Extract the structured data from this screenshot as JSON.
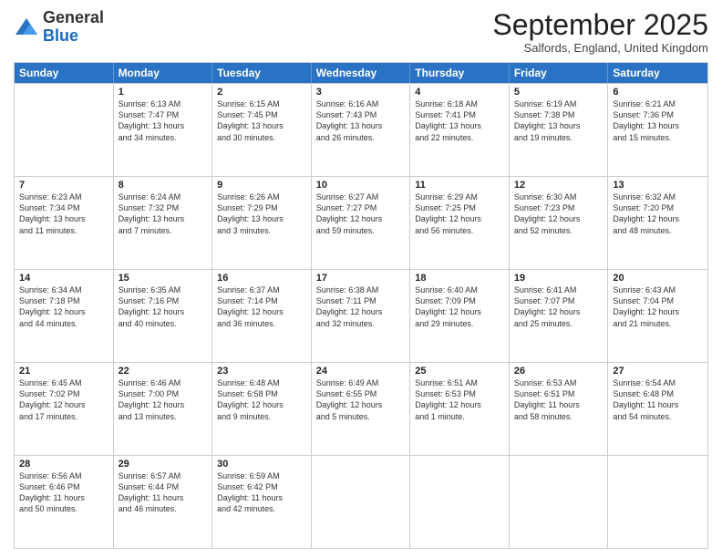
{
  "logo": {
    "general": "General",
    "blue": "Blue"
  },
  "header": {
    "month": "September 2025",
    "location": "Salfords, England, United Kingdom"
  },
  "days": [
    "Sunday",
    "Monday",
    "Tuesday",
    "Wednesday",
    "Thursday",
    "Friday",
    "Saturday"
  ],
  "weeks": [
    [
      {
        "date": "",
        "info": ""
      },
      {
        "date": "1",
        "info": "Sunrise: 6:13 AM\nSunset: 7:47 PM\nDaylight: 13 hours\nand 34 minutes."
      },
      {
        "date": "2",
        "info": "Sunrise: 6:15 AM\nSunset: 7:45 PM\nDaylight: 13 hours\nand 30 minutes."
      },
      {
        "date": "3",
        "info": "Sunrise: 6:16 AM\nSunset: 7:43 PM\nDaylight: 13 hours\nand 26 minutes."
      },
      {
        "date": "4",
        "info": "Sunrise: 6:18 AM\nSunset: 7:41 PM\nDaylight: 13 hours\nand 22 minutes."
      },
      {
        "date": "5",
        "info": "Sunrise: 6:19 AM\nSunset: 7:38 PM\nDaylight: 13 hours\nand 19 minutes."
      },
      {
        "date": "6",
        "info": "Sunrise: 6:21 AM\nSunset: 7:36 PM\nDaylight: 13 hours\nand 15 minutes."
      }
    ],
    [
      {
        "date": "7",
        "info": "Sunrise: 6:23 AM\nSunset: 7:34 PM\nDaylight: 13 hours\nand 11 minutes."
      },
      {
        "date": "8",
        "info": "Sunrise: 6:24 AM\nSunset: 7:32 PM\nDaylight: 13 hours\nand 7 minutes."
      },
      {
        "date": "9",
        "info": "Sunrise: 6:26 AM\nSunset: 7:29 PM\nDaylight: 13 hours\nand 3 minutes."
      },
      {
        "date": "10",
        "info": "Sunrise: 6:27 AM\nSunset: 7:27 PM\nDaylight: 12 hours\nand 59 minutes."
      },
      {
        "date": "11",
        "info": "Sunrise: 6:29 AM\nSunset: 7:25 PM\nDaylight: 12 hours\nand 56 minutes."
      },
      {
        "date": "12",
        "info": "Sunrise: 6:30 AM\nSunset: 7:23 PM\nDaylight: 12 hours\nand 52 minutes."
      },
      {
        "date": "13",
        "info": "Sunrise: 6:32 AM\nSunset: 7:20 PM\nDaylight: 12 hours\nand 48 minutes."
      }
    ],
    [
      {
        "date": "14",
        "info": "Sunrise: 6:34 AM\nSunset: 7:18 PM\nDaylight: 12 hours\nand 44 minutes."
      },
      {
        "date": "15",
        "info": "Sunrise: 6:35 AM\nSunset: 7:16 PM\nDaylight: 12 hours\nand 40 minutes."
      },
      {
        "date": "16",
        "info": "Sunrise: 6:37 AM\nSunset: 7:14 PM\nDaylight: 12 hours\nand 36 minutes."
      },
      {
        "date": "17",
        "info": "Sunrise: 6:38 AM\nSunset: 7:11 PM\nDaylight: 12 hours\nand 32 minutes."
      },
      {
        "date": "18",
        "info": "Sunrise: 6:40 AM\nSunset: 7:09 PM\nDaylight: 12 hours\nand 29 minutes."
      },
      {
        "date": "19",
        "info": "Sunrise: 6:41 AM\nSunset: 7:07 PM\nDaylight: 12 hours\nand 25 minutes."
      },
      {
        "date": "20",
        "info": "Sunrise: 6:43 AM\nSunset: 7:04 PM\nDaylight: 12 hours\nand 21 minutes."
      }
    ],
    [
      {
        "date": "21",
        "info": "Sunrise: 6:45 AM\nSunset: 7:02 PM\nDaylight: 12 hours\nand 17 minutes."
      },
      {
        "date": "22",
        "info": "Sunrise: 6:46 AM\nSunset: 7:00 PM\nDaylight: 12 hours\nand 13 minutes."
      },
      {
        "date": "23",
        "info": "Sunrise: 6:48 AM\nSunset: 6:58 PM\nDaylight: 12 hours\nand 9 minutes."
      },
      {
        "date": "24",
        "info": "Sunrise: 6:49 AM\nSunset: 6:55 PM\nDaylight: 12 hours\nand 5 minutes."
      },
      {
        "date": "25",
        "info": "Sunrise: 6:51 AM\nSunset: 6:53 PM\nDaylight: 12 hours\nand 1 minute."
      },
      {
        "date": "26",
        "info": "Sunrise: 6:53 AM\nSunset: 6:51 PM\nDaylight: 11 hours\nand 58 minutes."
      },
      {
        "date": "27",
        "info": "Sunrise: 6:54 AM\nSunset: 6:48 PM\nDaylight: 11 hours\nand 54 minutes."
      }
    ],
    [
      {
        "date": "28",
        "info": "Sunrise: 6:56 AM\nSunset: 6:46 PM\nDaylight: 11 hours\nand 50 minutes."
      },
      {
        "date": "29",
        "info": "Sunrise: 6:57 AM\nSunset: 6:44 PM\nDaylight: 11 hours\nand 46 minutes."
      },
      {
        "date": "30",
        "info": "Sunrise: 6:59 AM\nSunset: 6:42 PM\nDaylight: 11 hours\nand 42 minutes."
      },
      {
        "date": "",
        "info": ""
      },
      {
        "date": "",
        "info": ""
      },
      {
        "date": "",
        "info": ""
      },
      {
        "date": "",
        "info": ""
      }
    ]
  ]
}
